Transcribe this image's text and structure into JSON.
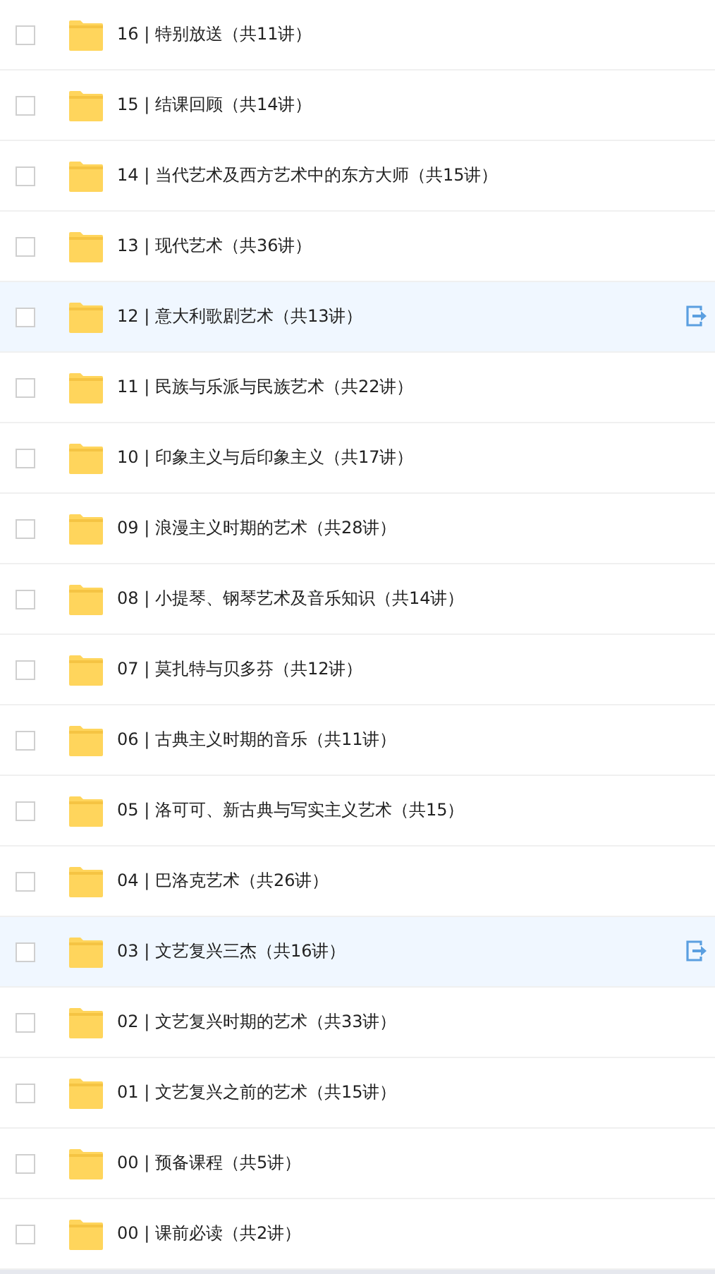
{
  "folders": [
    {
      "name": "16 | 特别放送（共11讲）",
      "checked": false,
      "highlighted": false
    },
    {
      "name": "15 | 结课回顾（共14讲）",
      "checked": false,
      "highlighted": false
    },
    {
      "name": "14 | 当代艺术及西方艺术中的东方大师（共15讲）",
      "checked": false,
      "highlighted": false
    },
    {
      "name": "13 | 现代艺术（共36讲）",
      "checked": false,
      "highlighted": false
    },
    {
      "name": "12 | 意大利歌剧艺术（共13讲）",
      "checked": false,
      "highlighted": true
    },
    {
      "name": "11 | 民族与乐派与民族艺术（共22讲）",
      "checked": false,
      "highlighted": false
    },
    {
      "name": "10 | 印象主义与后印象主义（共17讲）",
      "checked": false,
      "highlighted": false
    },
    {
      "name": "09 | 浪漫主义时期的艺术（共28讲）",
      "checked": false,
      "highlighted": false
    },
    {
      "name": "08 | 小提琴、钢琴艺术及音乐知识（共14讲）",
      "checked": false,
      "highlighted": false
    },
    {
      "name": "07 | 莫扎特与贝多芬（共12讲）",
      "checked": false,
      "highlighted": false
    },
    {
      "name": "06 | 古典主义时期的音乐（共11讲）",
      "checked": false,
      "highlighted": false
    },
    {
      "name": "05 | 洛可可、新古典与写实主义艺术（共15）",
      "checked": false,
      "highlighted": false
    },
    {
      "name": "04 | 巴洛克艺术（共26讲）",
      "checked": false,
      "highlighted": false
    },
    {
      "name": "03 | 文艺复兴三杰（共16讲）",
      "checked": false,
      "highlighted": true
    },
    {
      "name": "02 | 文艺复兴时期的艺术（共33讲）",
      "checked": false,
      "highlighted": false
    },
    {
      "name": "01 | 文艺复兴之前的艺术（共15讲）",
      "checked": false,
      "highlighted": false
    },
    {
      "name": "00 | 预备课程（共5讲）",
      "checked": false,
      "highlighted": false
    },
    {
      "name": "00 | 课前必读（共2讲）",
      "checked": false,
      "highlighted": false
    }
  ]
}
